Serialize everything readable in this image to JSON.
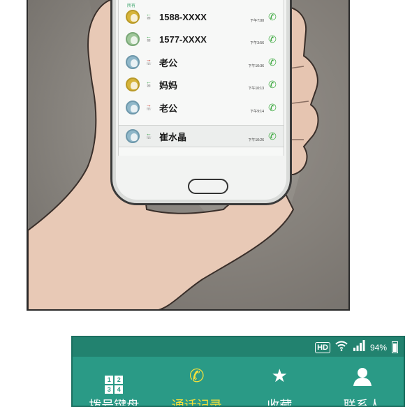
{
  "phone": {
    "screen_header": "所有",
    "call_log": [
      {
        "name": "1588-XXXX",
        "time": "下午7:00",
        "direction": "incoming",
        "avatar": "yellow"
      },
      {
        "name": "1577-XXXX",
        "time": "下午3:56",
        "direction": "incoming",
        "avatar": "green"
      },
      {
        "name": "老公",
        "time": "下午10:36",
        "direction": "outgoing",
        "avatar": "blue"
      },
      {
        "name": "妈妈",
        "time": "下午10:13",
        "direction": "incoming",
        "avatar": "yellow"
      },
      {
        "name": "老公",
        "time": "下午9:14",
        "direction": "outgoing",
        "avatar": "blue"
      },
      {
        "name": "崔水晶",
        "time": "下午10:26",
        "direction": "incoming",
        "avatar": "blue",
        "selected": true
      }
    ]
  },
  "status_bar": {
    "hd": "HD",
    "battery_percent": "94%"
  },
  "tabs": [
    {
      "label": "拨号键盘",
      "icon": "keypad-icon",
      "active": false
    },
    {
      "label": "通话记录",
      "icon": "call-log-icon",
      "active": true
    },
    {
      "label": "收藏",
      "icon": "star-icon",
      "active": false
    },
    {
      "label": "联系人",
      "icon": "person-icon",
      "active": false
    }
  ],
  "colors": {
    "bar_bg": "#2a9a86",
    "active_tab": "#f3e03c",
    "incoming": "#3aa34a",
    "outgoing": "#d23a2b"
  }
}
